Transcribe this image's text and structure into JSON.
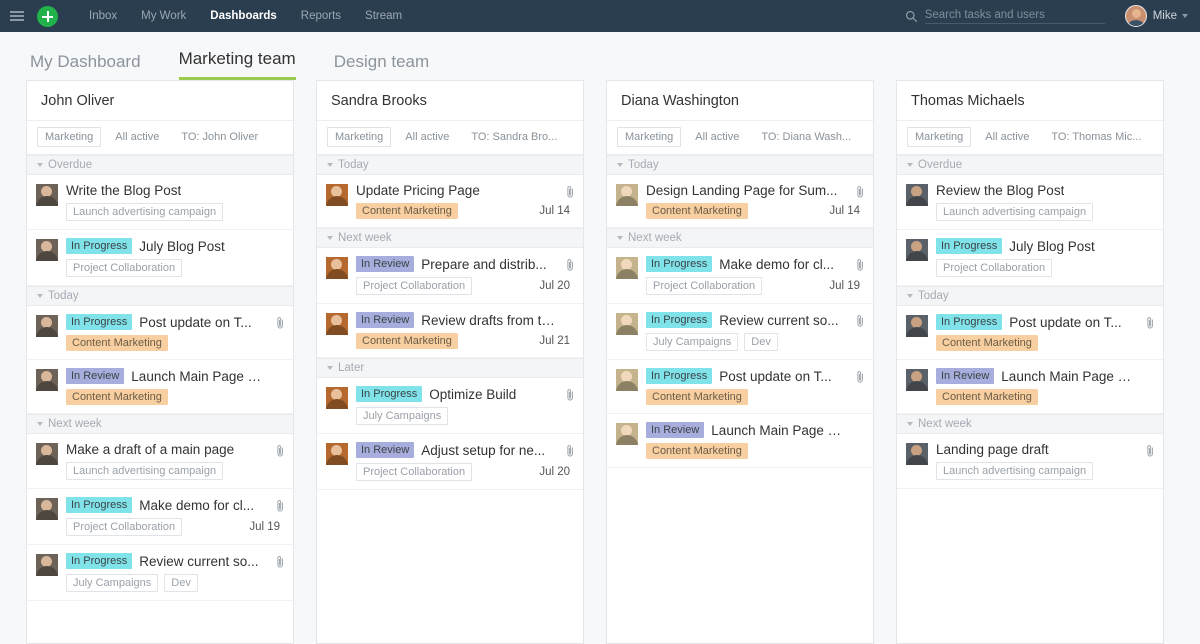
{
  "topbar": {
    "menu_icon": "hamburger-icon",
    "add_icon": "plus-icon",
    "nav": [
      {
        "label": "Inbox",
        "active": false
      },
      {
        "label": "My Work",
        "active": false
      },
      {
        "label": "Dashboards",
        "active": true
      },
      {
        "label": "Reports",
        "active": false
      },
      {
        "label": "Stream",
        "active": false
      }
    ],
    "search": {
      "icon": "search-icon",
      "placeholder": "Search tasks and users",
      "value": ""
    },
    "user": {
      "name": "Mike",
      "avatar": "user-avatar",
      "caret": "chevron-down-icon"
    }
  },
  "tabs": [
    {
      "label": "My Dashboard",
      "active": false
    },
    {
      "label": "Marketing team",
      "active": true
    },
    {
      "label": "Design team",
      "active": false
    }
  ],
  "colors": {
    "accent": "#9acb4e",
    "topbar_bg": "#2b3e50",
    "add_button": "#21b24b",
    "in_progress": "#7fe3e9",
    "in_review": "#a7aedd",
    "tag_orange": "#f8cfa0"
  },
  "columns": [
    {
      "title": "John Oliver",
      "avatar_color": "#6c6257",
      "avatar_skin": "#d8b79a",
      "filters": [
        "Marketing",
        "All active",
        "TO: John Oliver"
      ],
      "sections": [
        {
          "label": "Overdue",
          "tasks": [
            {
              "status": "",
              "title": "Write the Blog Post",
              "tags": [
                {
                  "text": "Launch advertising campaign",
                  "type": "plain"
                }
              ],
              "date": "",
              "attachment": false
            },
            {
              "status": "In Progress",
              "title": "July Blog Post",
              "tags": [
                {
                  "text": "Project Collaboration",
                  "type": "plain"
                }
              ],
              "date": "",
              "attachment": false
            }
          ]
        },
        {
          "label": "Today",
          "tasks": [
            {
              "status": "In Progress",
              "title": "Post update on T...",
              "tags": [
                {
                  "text": "Content Marketing",
                  "type": "orange"
                }
              ],
              "date": "",
              "attachment": true
            },
            {
              "status": "In Review",
              "title": "Launch Main Page Ex...",
              "tags": [
                {
                  "text": "Content Marketing",
                  "type": "orange"
                }
              ],
              "date": "",
              "attachment": false
            }
          ]
        },
        {
          "label": "Next week",
          "tasks": [
            {
              "status": "",
              "title": "Make a draft of a main page",
              "tags": [
                {
                  "text": "Launch advertising campaign",
                  "type": "plain"
                }
              ],
              "date": "",
              "attachment": true
            },
            {
              "status": "In Progress",
              "title": "Make demo for cl...",
              "tags": [
                {
                  "text": "Project Collaboration",
                  "type": "plain"
                }
              ],
              "date": "Jul 19",
              "attachment": true
            },
            {
              "status": "In Progress",
              "title": "Review current so...",
              "tags": [
                {
                  "text": "July Campaigns",
                  "type": "plain"
                },
                {
                  "text": "Dev",
                  "type": "plain"
                }
              ],
              "date": "",
              "attachment": true
            }
          ]
        }
      ]
    },
    {
      "title": "Sandra Brooks",
      "avatar_color": "#b5692f",
      "avatar_skin": "#e8c09a",
      "filters": [
        "Marketing",
        "All active",
        "TO: Sandra Bro..."
      ],
      "sections": [
        {
          "label": "Today",
          "tasks": [
            {
              "status": "",
              "title": "Update Pricing Page",
              "tags": [
                {
                  "text": "Content Marketing",
                  "type": "orange"
                }
              ],
              "date": "Jul 14",
              "attachment": true
            }
          ]
        },
        {
          "label": "Next week",
          "tasks": [
            {
              "status": "In Review",
              "title": "Prepare and distrib...",
              "tags": [
                {
                  "text": "Project Collaboration",
                  "type": "plain"
                }
              ],
              "date": "Jul 20",
              "attachment": true
            },
            {
              "status": "In Review",
              "title": "Review drafts from th...",
              "tags": [
                {
                  "text": "Content Marketing",
                  "type": "orange"
                }
              ],
              "date": "Jul 21",
              "attachment": false
            }
          ]
        },
        {
          "label": "Later",
          "tasks": [
            {
              "status": "In Progress",
              "title": "Optimize Build",
              "tags": [
                {
                  "text": "July Campaigns",
                  "type": "plain"
                }
              ],
              "date": "",
              "attachment": true
            },
            {
              "status": "In Review",
              "title": "Adjust setup for ne...",
              "tags": [
                {
                  "text": "Project Collaboration",
                  "type": "plain"
                }
              ],
              "date": "Jul 20",
              "attachment": true
            }
          ]
        }
      ]
    },
    {
      "title": "Diana Washington",
      "avatar_color": "#c4b38c",
      "avatar_skin": "#f0d8bc",
      "filters": [
        "Marketing",
        "All active",
        "TO: Diana Wash..."
      ],
      "sections": [
        {
          "label": "Today",
          "tasks": [
            {
              "status": "",
              "title": "Design Landing Page for Sum...",
              "tags": [
                {
                  "text": "Content Marketing",
                  "type": "orange"
                }
              ],
              "date": "Jul 14",
              "attachment": true
            }
          ]
        },
        {
          "label": "Next week",
          "tasks": [
            {
              "status": "In Progress",
              "title": "Make demo for cl...",
              "tags": [
                {
                  "text": "Project Collaboration",
                  "type": "plain"
                }
              ],
              "date": "Jul 19",
              "attachment": true
            },
            {
              "status": "In Progress",
              "title": "Review current so...",
              "tags": [
                {
                  "text": "July Campaigns",
                  "type": "plain"
                },
                {
                  "text": "Dev",
                  "type": "plain"
                }
              ],
              "date": "",
              "attachment": true
            },
            {
              "status": "In Progress",
              "title": "Post update on T...",
              "tags": [
                {
                  "text": "Content Marketing",
                  "type": "orange"
                }
              ],
              "date": "",
              "attachment": true
            },
            {
              "status": "In Review",
              "title": "Launch Main Page Ex...",
              "tags": [
                {
                  "text": "Content Marketing",
                  "type": "orange"
                }
              ],
              "date": "",
              "attachment": false
            }
          ]
        }
      ]
    },
    {
      "title": "Thomas Michaels",
      "avatar_color": "#5b6168",
      "avatar_skin": "#c9a183",
      "filters": [
        "Marketing",
        "All active",
        "TO: Thomas Mic..."
      ],
      "sections": [
        {
          "label": "Overdue",
          "tasks": [
            {
              "status": "",
              "title": "Review the Blog Post",
              "tags": [
                {
                  "text": "Launch advertising campaign",
                  "type": "plain"
                }
              ],
              "date": "",
              "attachment": false
            },
            {
              "status": "In Progress",
              "title": "July Blog Post",
              "tags": [
                {
                  "text": "Project Collaboration",
                  "type": "plain"
                }
              ],
              "date": "",
              "attachment": false
            }
          ]
        },
        {
          "label": "Today",
          "tasks": [
            {
              "status": "In Progress",
              "title": "Post update on T...",
              "tags": [
                {
                  "text": "Content Marketing",
                  "type": "orange"
                }
              ],
              "date": "",
              "attachment": true
            },
            {
              "status": "In Review",
              "title": "Launch Main Page Ex...",
              "tags": [
                {
                  "text": "Content Marketing",
                  "type": "orange"
                }
              ],
              "date": "",
              "attachment": false
            }
          ]
        },
        {
          "label": "Next week",
          "tasks": [
            {
              "status": "",
              "title": "Landing page draft",
              "tags": [
                {
                  "text": "Launch advertising campaign",
                  "type": "plain"
                }
              ],
              "date": "",
              "attachment": true
            }
          ]
        }
      ]
    }
  ]
}
